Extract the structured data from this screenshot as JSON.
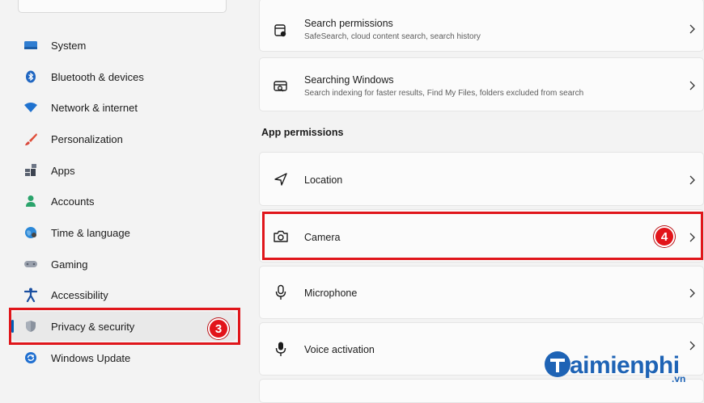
{
  "sidebar": {
    "items": [
      {
        "label": "System",
        "icon": "monitor-icon"
      },
      {
        "label": "Bluetooth & devices",
        "icon": "bluetooth-icon"
      },
      {
        "label": "Network & internet",
        "icon": "wifi-icon"
      },
      {
        "label": "Personalization",
        "icon": "brush-icon"
      },
      {
        "label": "Apps",
        "icon": "apps-icon"
      },
      {
        "label": "Accounts",
        "icon": "person-icon"
      },
      {
        "label": "Time & language",
        "icon": "globe-clock-icon"
      },
      {
        "label": "Gaming",
        "icon": "gamepad-icon"
      },
      {
        "label": "Accessibility",
        "icon": "accessibility-icon"
      },
      {
        "label": "Privacy & security",
        "icon": "shield-icon",
        "selected": true
      },
      {
        "label": "Windows Update",
        "icon": "update-icon"
      }
    ]
  },
  "content": {
    "top_cards": [
      {
        "title": "Search permissions",
        "subtitle": "SafeSearch, cloud content search, search history",
        "icon": "search-permissions-icon"
      },
      {
        "title": "Searching Windows",
        "subtitle": "Search indexing for faster results, Find My Files, folders excluded from search",
        "icon": "searching-windows-icon"
      }
    ],
    "section_heading": "App permissions",
    "app_permissions": [
      {
        "title": "Location",
        "icon": "location-icon"
      },
      {
        "title": "Camera",
        "icon": "camera-icon"
      },
      {
        "title": "Microphone",
        "icon": "microphone-icon"
      },
      {
        "title": "Voice activation",
        "icon": "voice-activation-icon"
      }
    ]
  },
  "annotations": {
    "step3": "3",
    "step4": "4",
    "highlight_color": "#e0161b"
  },
  "watermark": {
    "text": "aimienphi",
    "suffix": ".vn",
    "brand_color": "#1e63b5"
  },
  "colors": {
    "accent": "#005fb8",
    "background": "#f3f3f3",
    "card": "#fbfbfb"
  }
}
